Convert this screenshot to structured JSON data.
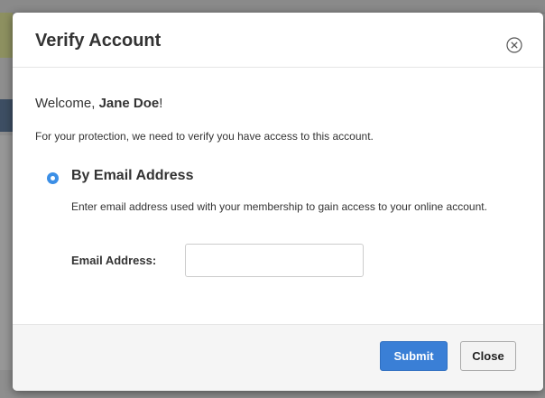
{
  "modal": {
    "title": "Verify Account",
    "close_icon": "close-circle-icon"
  },
  "body": {
    "welcome_prefix": "Welcome, ",
    "user_name": "Jane Doe",
    "welcome_suffix": "!",
    "protection_text": "For your protection, we need to verify you have access to this account.",
    "option": {
      "label": "By Email Address",
      "selected": true,
      "description": "Enter email address used with your membership to gain access to your online account."
    },
    "email_field": {
      "label": "Email Address:",
      "value": "",
      "placeholder": ""
    }
  },
  "footer": {
    "submit_label": "Submit",
    "close_label": "Close"
  },
  "colors": {
    "accent": "#3a7fd6",
    "radio": "#3c8fe6",
    "text": "#333333"
  }
}
